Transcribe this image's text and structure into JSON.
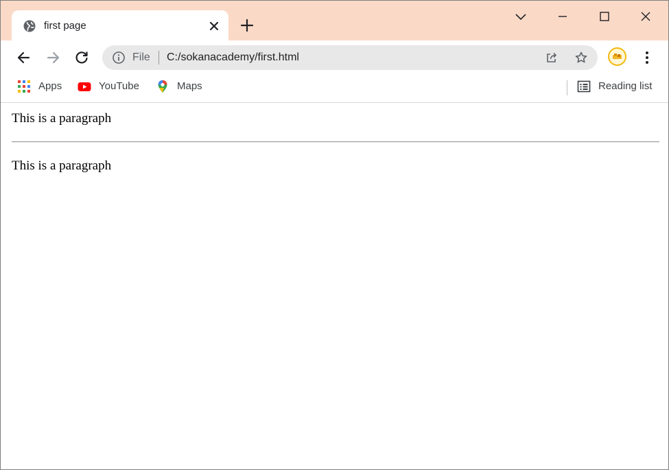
{
  "tab": {
    "title": "first page"
  },
  "omnibox": {
    "scheme_label": "File",
    "url": "C:/sokanacademy/first.html"
  },
  "bookmarks": [
    {
      "label": "Apps",
      "icon": "apps-grid-icon"
    },
    {
      "label": "YouTube",
      "icon": "youtube-icon"
    },
    {
      "label": "Maps",
      "icon": "maps-pin-icon"
    }
  ],
  "reading_list": {
    "label": "Reading list",
    "icon": "reading-list-icon"
  },
  "page": {
    "paragraphs": [
      "This is a paragraph",
      "This is a paragraph"
    ]
  },
  "colors": {
    "tabstrip": "#fbd9c7",
    "omnibox": "#e8e8e8",
    "youtube_red": "#ff0000",
    "avatar_ring": "#f2b90f"
  }
}
